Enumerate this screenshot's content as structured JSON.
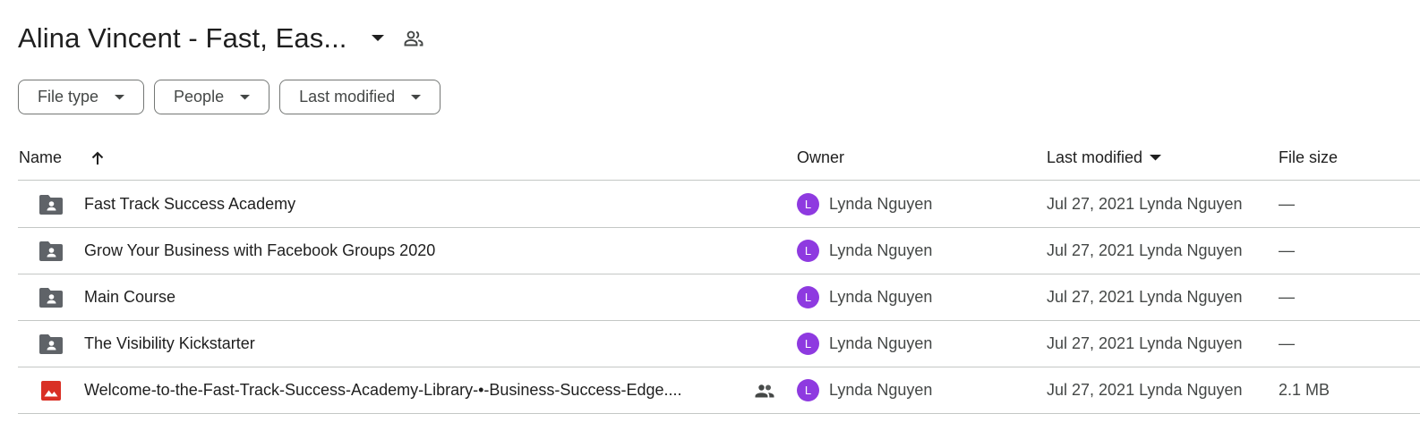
{
  "folder": {
    "title": "Alina Vincent - Fast, Eas..."
  },
  "filters": [
    {
      "label": "File type"
    },
    {
      "label": "People"
    },
    {
      "label": "Last modified"
    }
  ],
  "columns": {
    "name": "Name",
    "owner": "Owner",
    "last_modified": "Last modified",
    "file_size": "File size"
  },
  "rows": [
    {
      "icon": "shared-folder-icon",
      "name": "Fast Track Success Academy",
      "shared": false,
      "owner_initial": "L",
      "owner": "Lynda Nguyen",
      "modified": "Jul 27, 2021 Lynda Nguyen",
      "size": "—"
    },
    {
      "icon": "shared-folder-icon",
      "name": "Grow Your Business with Facebook Groups 2020",
      "shared": false,
      "owner_initial": "L",
      "owner": "Lynda Nguyen",
      "modified": "Jul 27, 2021 Lynda Nguyen",
      "size": "—"
    },
    {
      "icon": "shared-folder-icon",
      "name": "Main Course",
      "shared": false,
      "owner_initial": "L",
      "owner": "Lynda Nguyen",
      "modified": "Jul 27, 2021 Lynda Nguyen",
      "size": "—"
    },
    {
      "icon": "shared-folder-icon",
      "name": "The Visibility Kickstarter",
      "shared": false,
      "owner_initial": "L",
      "owner": "Lynda Nguyen",
      "modified": "Jul 27, 2021 Lynda Nguyen",
      "size": "—"
    },
    {
      "icon": "image-file-icon",
      "name": "Welcome-to-the-Fast-Track-Success-Academy-Library-•-Business-Success-Edge....",
      "shared": true,
      "owner_initial": "L",
      "owner": "Lynda Nguyen",
      "modified": "Jul 27, 2021 Lynda Nguyen",
      "size": "2.1 MB"
    }
  ],
  "colors": {
    "avatar": "#8e3ae0",
    "folder_icon": "#5f6368",
    "image_icon": "#d93025",
    "divider": "#c4c7c5"
  }
}
